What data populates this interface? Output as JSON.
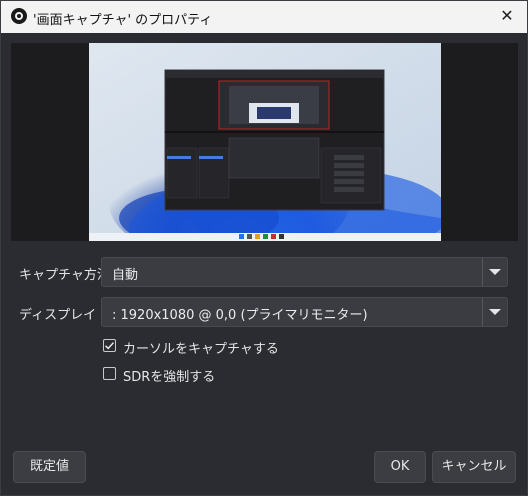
{
  "window": {
    "title": "'画面キャプチャ' のプロパティ",
    "close_glyph": "✕"
  },
  "preview": {
    "icon": "display-capture-preview"
  },
  "form": {
    "capture_method": {
      "label": "キャプチャ方法",
      "value": "自動"
    },
    "display": {
      "label": "ディスプレイ",
      "value": ": 1920x1080 @ 0,0 (プライマリモニター)"
    },
    "capture_cursor": {
      "label": "カーソルをキャプチャする",
      "checked": true
    },
    "force_sdr": {
      "label": "SDRを強制する",
      "checked": false
    }
  },
  "buttons": {
    "defaults": "既定値",
    "ok": "OK",
    "cancel": "キャンセル"
  },
  "colors": {
    "accent": "#1a63d9",
    "background": "#2b2c31",
    "field": "#3b3c42"
  }
}
